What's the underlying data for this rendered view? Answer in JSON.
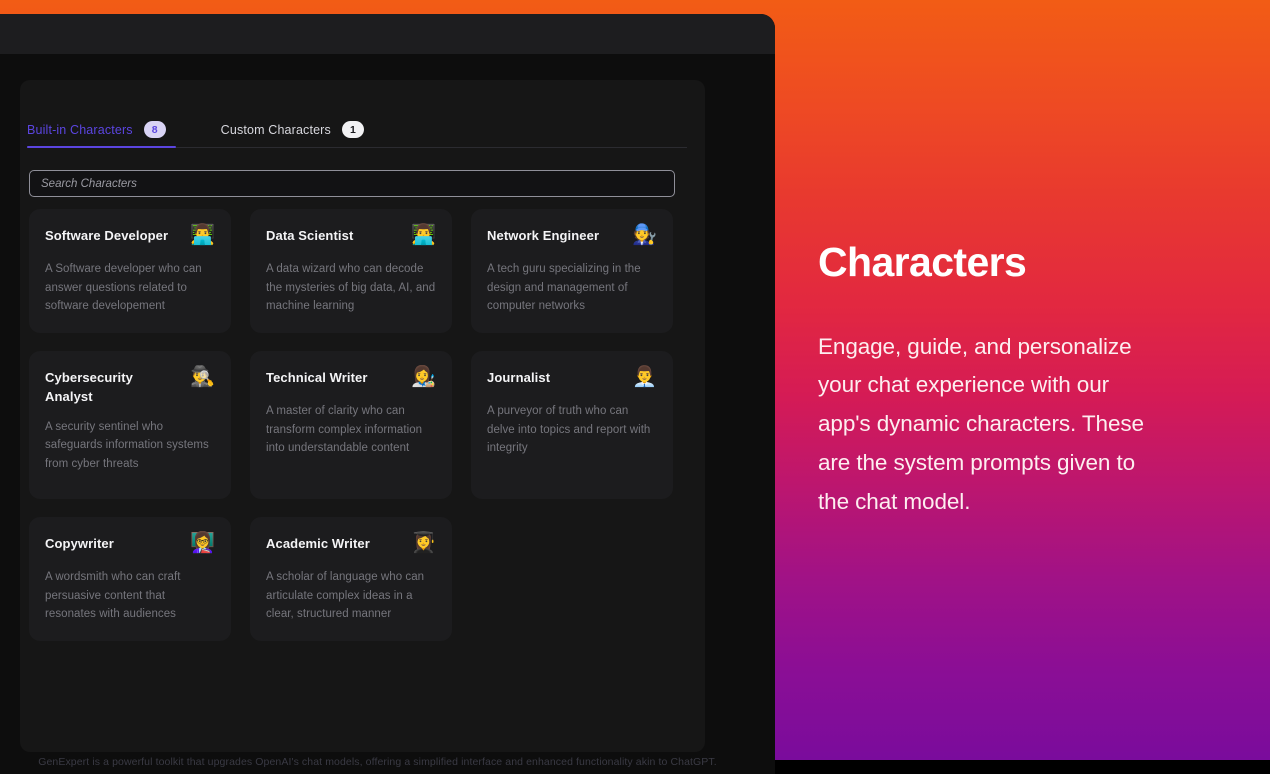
{
  "window": {
    "title_bar_label": ""
  },
  "tabs": [
    {
      "label": "Built-in Characters",
      "badge": "8",
      "active": true,
      "name": "tab-built-in-characters"
    },
    {
      "label": "Custom Characters",
      "badge": "1",
      "active": false,
      "name": "tab-custom-characters"
    }
  ],
  "search": {
    "placeholder": "Search Characters",
    "value": ""
  },
  "characters": [
    {
      "title": "Software Developer",
      "description": "A Software developer who can answer questions related to software developement",
      "emoji": "👨‍💻",
      "icon_name": "software-developer-emoji"
    },
    {
      "title": "Data Scientist",
      "description": "A data wizard who can decode the mysteries of big data, AI, and machine learning",
      "emoji": "👨‍💻",
      "icon_name": "data-scientist-emoji"
    },
    {
      "title": "Network Engineer",
      "description": "A tech guru specializing in the design and management of computer networks",
      "emoji": "🧑‍🔧",
      "icon_name": "network-engineer-emoji"
    },
    {
      "title": "Cybersecurity Analyst",
      "description": "A security sentinel who safeguards information systems from cyber threats",
      "emoji": "🕵️‍♂️",
      "icon_name": "cybersecurity-analyst-emoji"
    },
    {
      "title": "Technical Writer",
      "description": "A master of clarity who can transform complex information into understandable content",
      "emoji": "👩‍🎨",
      "icon_name": "technical-writer-emoji"
    },
    {
      "title": "Journalist",
      "description": "A purveyor of truth who can delve into topics and report with integrity",
      "emoji": "👨‍💼",
      "icon_name": "journalist-emoji"
    },
    {
      "title": "Copywriter",
      "description": "A wordsmith who can craft persuasive content that resonates with audiences",
      "emoji": "👩‍🏫",
      "icon_name": "copywriter-emoji"
    },
    {
      "title": "Academic Writer",
      "description": "A scholar of language who can articulate complex ideas in a clear, structured manner",
      "emoji": "👩‍🎓",
      "icon_name": "academic-writer-emoji"
    }
  ],
  "footer": {
    "note": "GenExpert is a powerful toolkit that upgrades OpenAI's chat models, offering a simplified interface and enhanced functionality akin to ChatGPT."
  },
  "hero": {
    "title": "Characters",
    "body": "Engage, guide, and personalize your chat experience with our app's dynamic characters. These are the system prompts given to the chat model."
  },
  "colors": {
    "accent_purple": "#5B45E0",
    "gradient_top": "#F25C15",
    "gradient_mid": "#D51B55",
    "gradient_bottom": "#7A0C9C",
    "card_bg": "#1c1c1e",
    "panel_bg": "#161616",
    "window_bg": "#0d0d0d"
  }
}
